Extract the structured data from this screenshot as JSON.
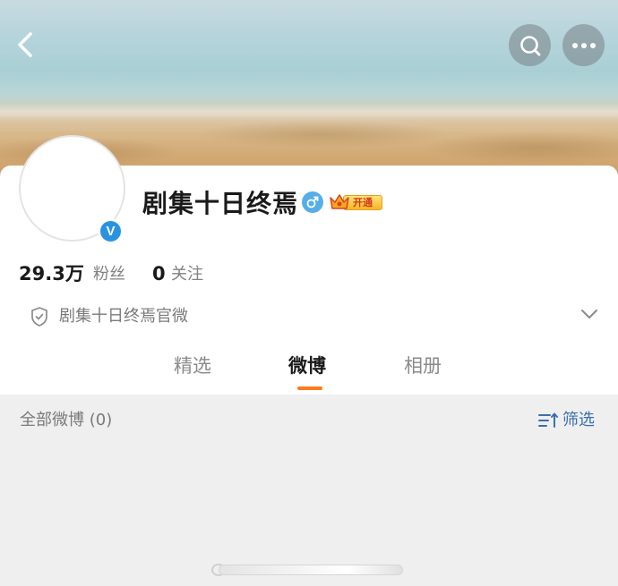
{
  "profile": {
    "name": "剧集十日终焉",
    "vip_label": "开通",
    "fans_count": "29.3万",
    "fans_label": "粉丝",
    "following_count": "0",
    "following_label": "关注",
    "verify_text": "剧集十日终焉官微",
    "verified_badge": "V"
  },
  "tabs": [
    {
      "label": "精选",
      "active": false
    },
    {
      "label": "微博",
      "active": true
    },
    {
      "label": "相册",
      "active": false
    }
  ],
  "feed": {
    "all_label": "全部微博 (0)",
    "filter_label": "筛选"
  },
  "icons": {
    "back": "back-arrow-icon",
    "search": "search-icon",
    "more": "more-icon",
    "gender": "male-icon",
    "vip": "crown-icon",
    "verify": "shield-icon",
    "expand": "chevron-down-icon",
    "filter": "filter-icon"
  },
  "colors": {
    "accent": "#ff7a1c",
    "verified_blue": "#2a93e0",
    "link_blue": "#3a6fb0"
  }
}
